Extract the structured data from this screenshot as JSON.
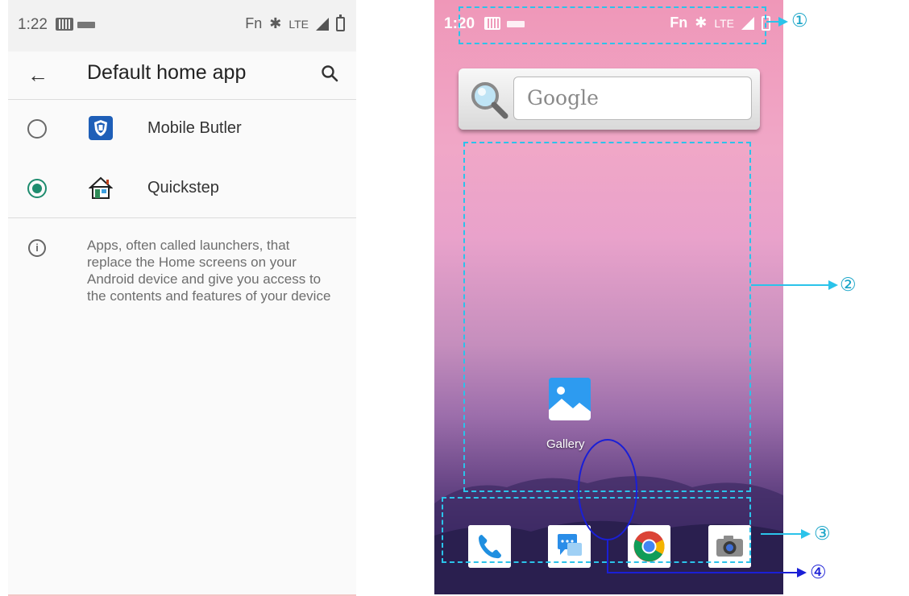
{
  "settings": {
    "status_bar": {
      "time": "1:22",
      "fn": "Fn",
      "bluetooth_icon": "bluetooth-icon",
      "network": "LTE"
    },
    "toolbar": {
      "back_icon": "←",
      "title": "Default home app",
      "search_icon": "search-icon"
    },
    "options": [
      {
        "label": "Mobile Butler",
        "selected": false,
        "icon": "mobile-butler-icon"
      },
      {
        "label": "Quickstep",
        "selected": true,
        "icon": "quickstep-house-icon"
      }
    ],
    "info": {
      "icon": "info-icon",
      "text": "Apps, often called launchers, that replace the Home screens on your Android device and give you access to the contents and features of your device"
    },
    "accent_color": "#1e8c6e"
  },
  "home": {
    "status_bar": {
      "time": "1:20",
      "fn": "Fn",
      "network": "LTE"
    },
    "search_widget": {
      "placeholder": "Google",
      "icon": "magnifier-icon"
    },
    "apps": [
      {
        "label": "Gallery",
        "icon": "gallery-icon"
      }
    ],
    "dock": [
      {
        "name": "phone",
        "icon": "phone-icon"
      },
      {
        "name": "messages",
        "icon": "messages-icon"
      },
      {
        "name": "chrome",
        "icon": "chrome-icon"
      },
      {
        "name": "camera",
        "icon": "camera-icon"
      }
    ]
  },
  "annotations": {
    "c1": "①",
    "c2": "②",
    "c3": "③",
    "c4": "④",
    "dash_color": "#2bc3ea",
    "arrow4_color": "#1a1fd6"
  }
}
